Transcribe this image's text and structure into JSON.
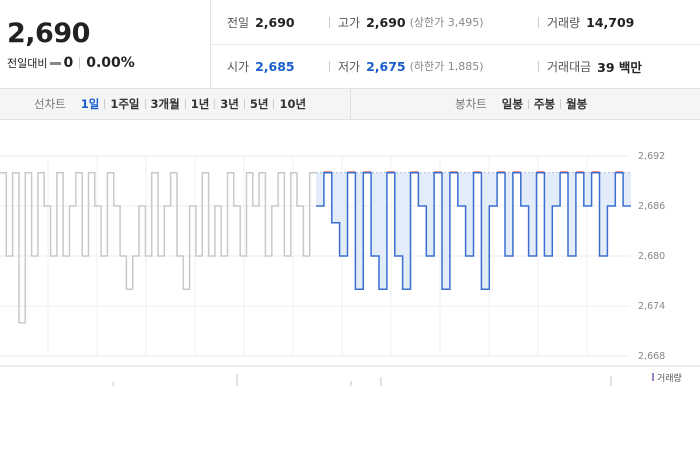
{
  "quote": {
    "price": "2,690",
    "change_label": "전일대비",
    "change_value": "0",
    "change_pct": "0.00%"
  },
  "info": {
    "prev_close": {
      "label": "전일",
      "value": "2,690"
    },
    "high": {
      "label": "고가",
      "value": "2,690",
      "sub": "(상한가 3,495)"
    },
    "volume": {
      "label": "거래량",
      "value": "14,709"
    },
    "open": {
      "label": "시가",
      "value": "2,685"
    },
    "low": {
      "label": "저가",
      "value": "2,675",
      "sub": "(하한가 1,885)"
    },
    "amount": {
      "label": "거래대금",
      "value": "39 백만"
    }
  },
  "line_tabs": {
    "title": "선차트",
    "items": [
      "1일",
      "1주일",
      "3개월",
      "1년",
      "3년",
      "5년",
      "10년"
    ],
    "active": 0
  },
  "candle_tabs": {
    "title": "봉차트",
    "items": [
      "일봉",
      "주봉",
      "월봉"
    ]
  },
  "colors": {
    "today_line": "#3a6fd1",
    "today_fill": "#e3ecf9",
    "prev_line": "#c9c9c9",
    "high_mark": "#e0403a",
    "axis_text": "#888888"
  },
  "chart_data": {
    "type": "line",
    "y_ticks": [
      "2,692",
      "2,686",
      "2,680",
      "2,674",
      "2,668"
    ],
    "ylim": [
      2668,
      2692
    ],
    "grid": true,
    "legend": "거래량",
    "series": [
      {
        "values": [
          2690,
          2680,
          2690,
          2672,
          2690,
          2680,
          2690,
          2686,
          2680,
          2690,
          2680,
          2686,
          2690,
          2680,
          2690,
          2686,
          2680,
          2690,
          2686,
          2680,
          2676,
          2680,
          2686,
          2680,
          2690,
          2680,
          2686,
          2690,
          2680,
          2676,
          2686,
          2680,
          2690,
          2680,
          2686,
          2680,
          2690,
          2686,
          2680,
          2690,
          2686,
          2690,
          2680,
          2686,
          2690,
          2680,
          2690,
          2686,
          2680,
          2690
        ]
      },
      {
        "values": [
          2686,
          2690,
          2684,
          2680,
          2690,
          2676,
          2690,
          2680,
          2676,
          2690,
          2680,
          2676,
          2690,
          2686,
          2680,
          2690,
          2676,
          2690,
          2686,
          2680,
          2690,
          2676,
          2686,
          2690,
          2680,
          2690,
          2686,
          2680,
          2690,
          2680,
          2686,
          2690,
          2680,
          2690,
          2686,
          2690,
          2680,
          2686,
          2690,
          2686
        ]
      }
    ]
  }
}
